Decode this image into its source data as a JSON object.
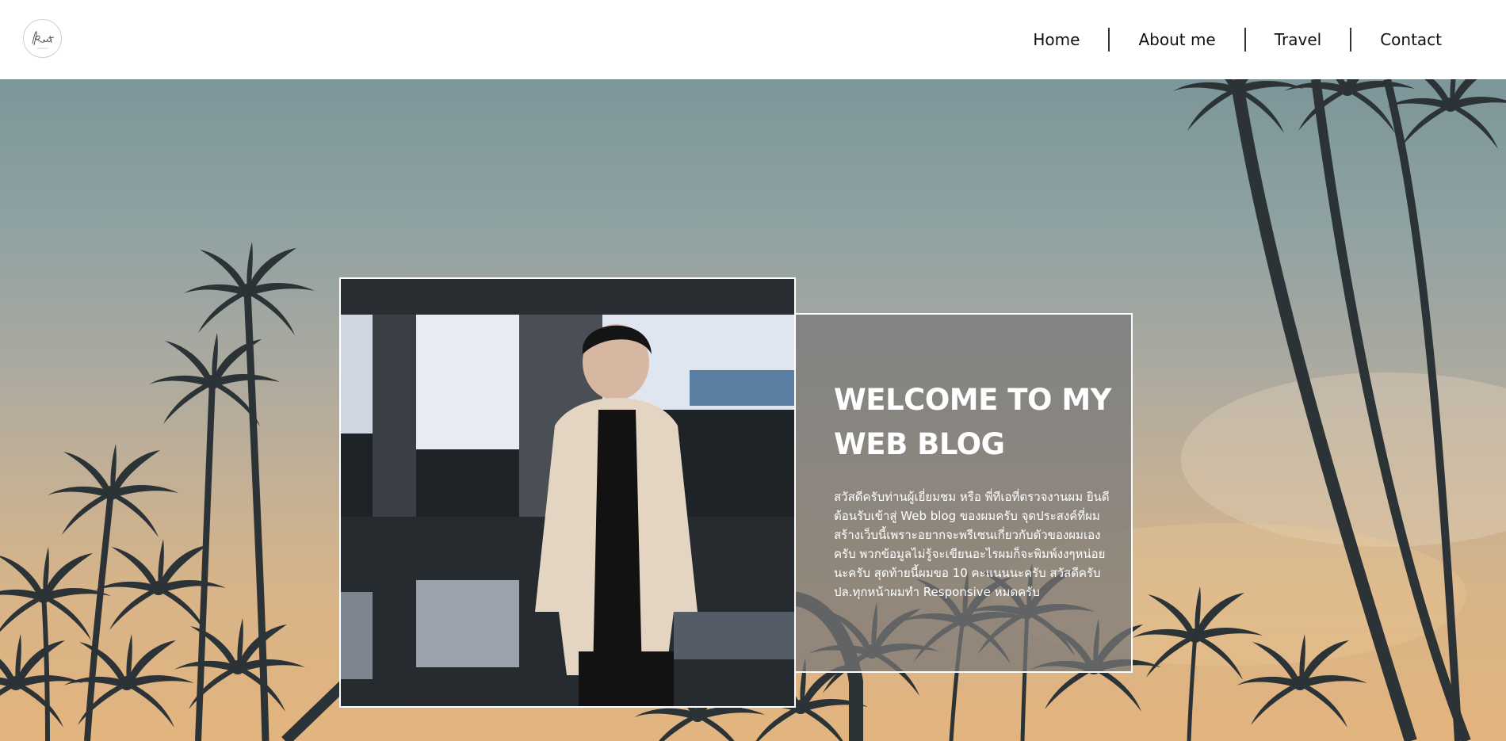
{
  "logo": {
    "icon": "signature-logo-icon"
  },
  "nav": {
    "items": [
      {
        "label": "Home"
      },
      {
        "label": "About me"
      },
      {
        "label": "Travel"
      },
      {
        "label": "Contact"
      }
    ]
  },
  "hero": {
    "background": "palm-trees-sunset",
    "photo": "portrait-photo",
    "card": {
      "title": "WELCOME TO MY WEB BLOG",
      "text": "สวัสดีครับท่านผู้เยี่ยมชม หรือ พี่ทีเอที่ตรวจงานผม ยินดีต้อนรับเข้าสู่ Web blog ของผมครับ จุดประสงค์ที่ผมสร้างเว็บนี้เพราะอยากจะพรีเซนเกี่ยวกับตัวของผมเองครับ พวกข้อมูลไม่รู้จะเขียนอะไรผมก็จะพิมพ์งงๆหน่อยนะครับ สุดท้ายนี้ผมขอ 10 คะแนนนะครับ สวัสดีครับ ปล.ทุกหน้าผมทำ Responsive หมดครับ"
    }
  },
  "colors": {
    "header_bg": "#ffffff",
    "nav_text": "#111111",
    "card_bg": "#767676",
    "card_border": "#ffffff"
  }
}
